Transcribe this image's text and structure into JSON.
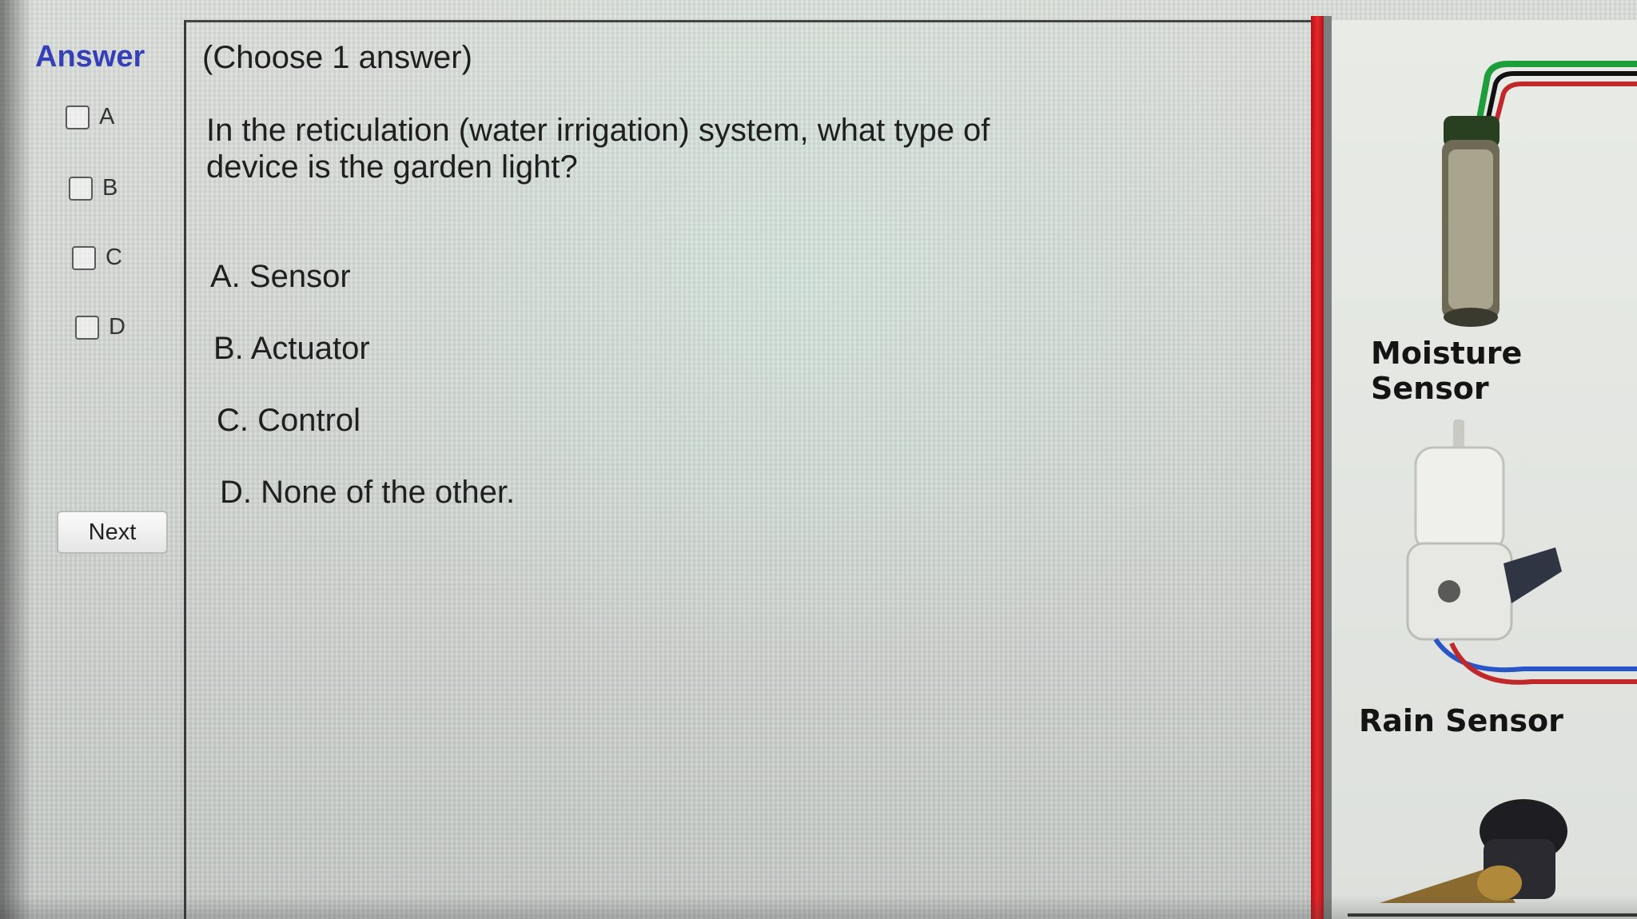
{
  "answer_panel": {
    "title": "Answer",
    "options": [
      "A",
      "B",
      "C",
      "D"
    ],
    "next_label": "Next"
  },
  "question": {
    "instruction": "(Choose 1 answer)",
    "text": "In the reticulation  (water irrigation) system, what type of device is the garden light?",
    "choices": [
      "A.  Sensor",
      "B.  Actuator",
      "C.  Control",
      "D.  None of the other."
    ]
  },
  "diagram": {
    "labels": [
      "Moisture Sensor",
      "Rain Sensor"
    ]
  },
  "colors": {
    "answer_title": "#3540b8",
    "divider": "#e32a2a",
    "wire_green": "#1e9e3a",
    "wire_red": "#c0282a",
    "wire_blue": "#2a55c8"
  }
}
